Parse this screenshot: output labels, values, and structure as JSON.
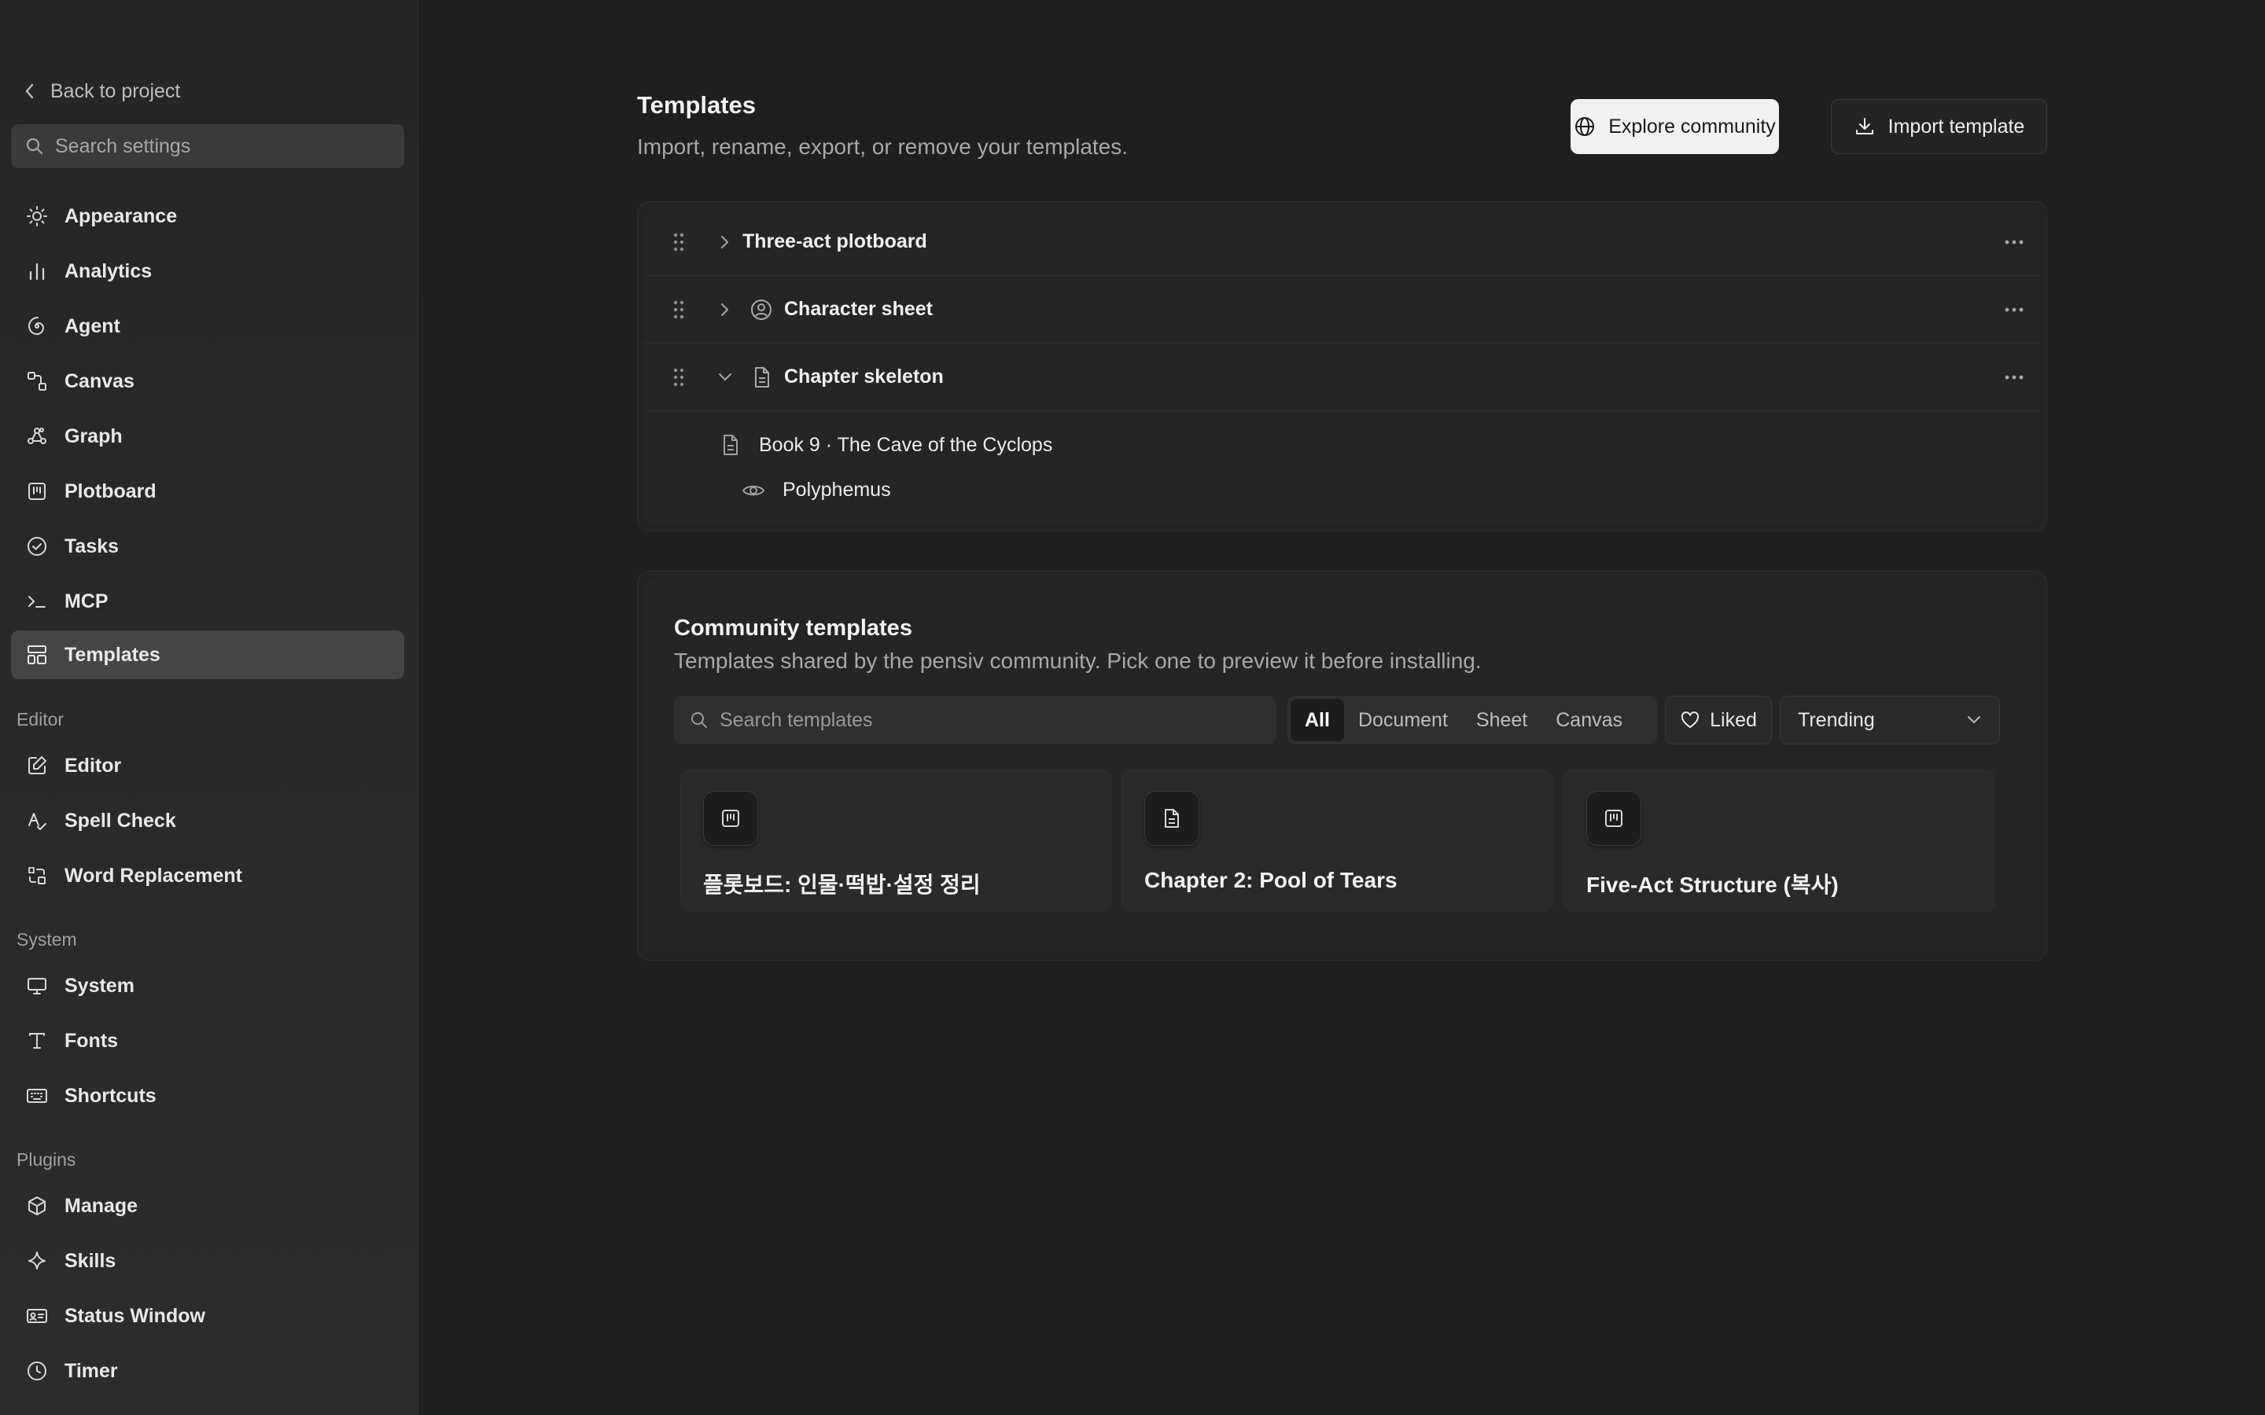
{
  "sidebar": {
    "back_label": "Back to project",
    "search_placeholder": "Search settings",
    "items": [
      {
        "label": "Appearance"
      },
      {
        "label": "Analytics"
      },
      {
        "label": "Agent"
      },
      {
        "label": "Canvas"
      },
      {
        "label": "Graph"
      },
      {
        "label": "Plotboard"
      },
      {
        "label": "Tasks"
      },
      {
        "label": "MCP"
      },
      {
        "label": "Templates",
        "active": true
      }
    ],
    "editor_section": {
      "label": "Editor",
      "items": [
        {
          "label": "Editor"
        },
        {
          "label": "Spell Check"
        },
        {
          "label": "Word Replacement"
        }
      ]
    },
    "system_section": {
      "label": "System",
      "items": [
        {
          "label": "System"
        },
        {
          "label": "Fonts"
        },
        {
          "label": "Shortcuts"
        }
      ]
    },
    "plugins_section": {
      "label": "Plugins",
      "items": [
        {
          "label": "Manage"
        },
        {
          "label": "Skills"
        },
        {
          "label": "Status Window"
        },
        {
          "label": "Timer"
        }
      ]
    }
  },
  "header": {
    "title": "Templates",
    "subtitle": "Import, rename, export, or remove your templates.",
    "explore_label": "Explore community",
    "import_label": "Import template"
  },
  "templates": [
    {
      "name": "Three-act plotboard",
      "expanded": false,
      "icon": "none"
    },
    {
      "name": "Character sheet",
      "expanded": false,
      "icon": "user-circle-icon"
    },
    {
      "name": "Chapter skeleton",
      "expanded": true,
      "icon": "document-icon",
      "children": [
        {
          "label": "Book 9 · The Cave of the Cyclops",
          "icon": "document-icon"
        },
        {
          "label": "Polyphemus",
          "icon": "eye-icon"
        }
      ]
    }
  ],
  "community": {
    "title": "Community templates",
    "subtitle": "Templates shared by the pensiv community. Pick one to preview it before installing.",
    "search_placeholder": "Search templates",
    "filters": [
      "All",
      "Document",
      "Sheet",
      "Canvas"
    ],
    "active_filter": "All",
    "liked_label": "Liked",
    "sort_value": "Trending",
    "cards": [
      {
        "title": "플롯보드: 인물·떡밥·설정 정리",
        "icon": "plotboard-icon"
      },
      {
        "title": "Chapter 2: Pool of Tears",
        "icon": "document-icon"
      },
      {
        "title": "Five-Act Structure (복사)",
        "icon": "plotboard-icon"
      }
    ]
  }
}
